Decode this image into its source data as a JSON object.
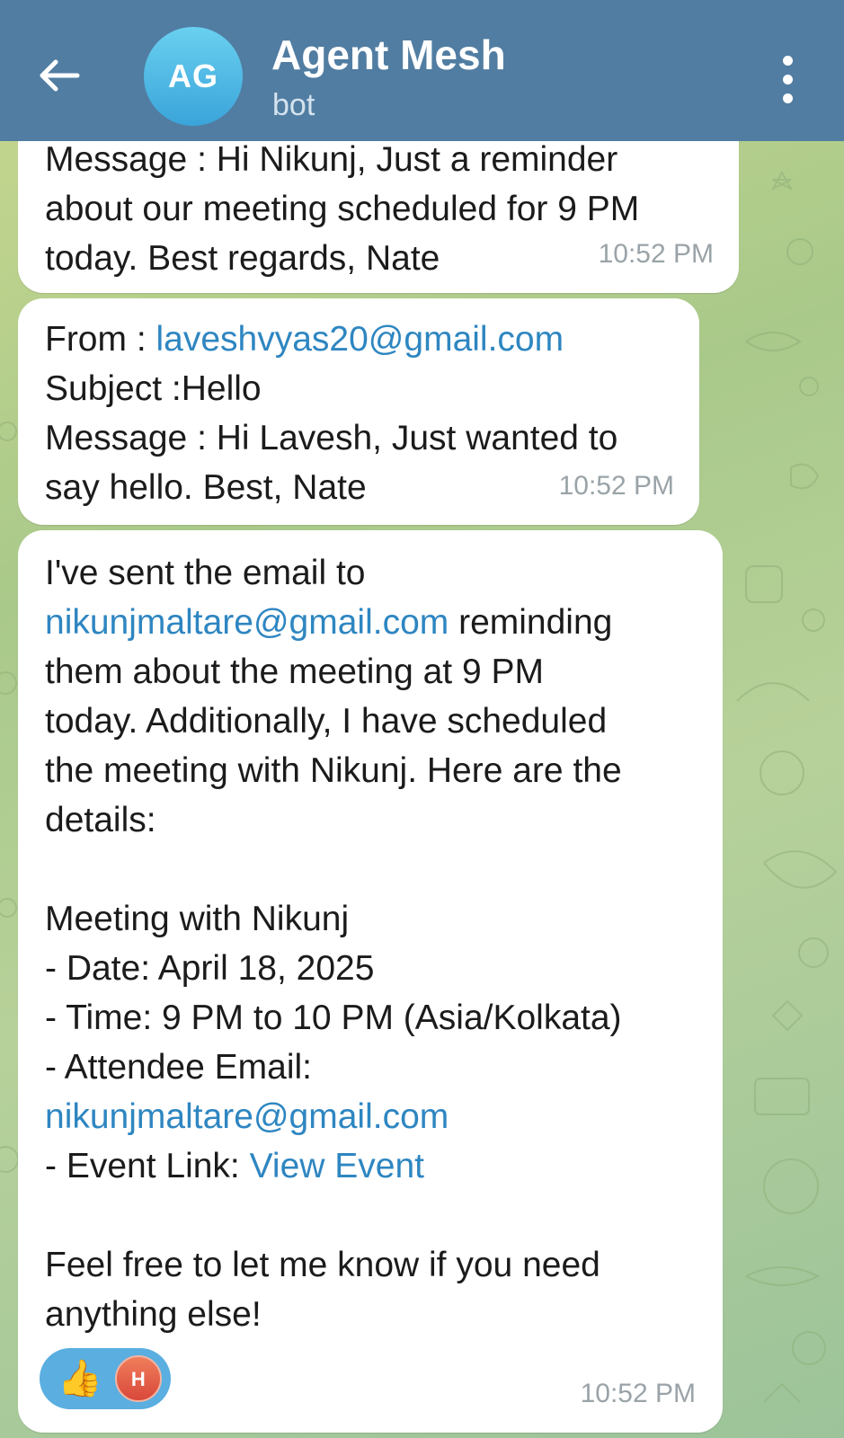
{
  "header": {
    "back_icon": "arrow-left-icon",
    "avatar_initials": "AG",
    "title": "Agent Mesh",
    "subtitle": "bot",
    "menu_icon": "more-vertical-icon"
  },
  "colors": {
    "header_bg": "#517da2",
    "link": "#2e86c1",
    "reaction_bg": "#5aaee0"
  },
  "messages": [
    {
      "lines": [
        "Message : Hi Nikunj, Just a reminder",
        "about our meeting scheduled for 9 PM",
        "today. Best regards, Nate"
      ],
      "time": "10:52 PM"
    },
    {
      "from_label": "From : ",
      "from_email": "laveshvyas20@gmail.com",
      "lines": [
        "Subject :Hello",
        "Message : Hi Lavesh, Just wanted to",
        "say hello. Best, Nate"
      ],
      "time": "10:52 PM"
    },
    {
      "line1": "I've sent the email to",
      "line2_link": "nikunjmaltare@gmail.com",
      "line2_rest": " reminding",
      "lines_a": [
        "them about the meeting at 9 PM",
        "today. Additionally, I have scheduled",
        "the meeting with Nikunj. Here are the",
        "details:"
      ],
      "lines_b": [
        "Meeting with Nikunj",
        "- Date: April 18, 2025",
        "- Time: 9 PM to 10 PM (Asia/Kolkata)",
        "- Attendee Email:"
      ],
      "attendee_email": "nikunjmaltare@gmail.com",
      "event_link_label": "- Event Link: ",
      "event_link_text": "View Event",
      "lines_c": [
        "Feel free to let me know if you need",
        "anything else!"
      ],
      "reaction": {
        "emoji": "👍",
        "user_initial": "H"
      },
      "time": "10:52 PM"
    }
  ]
}
